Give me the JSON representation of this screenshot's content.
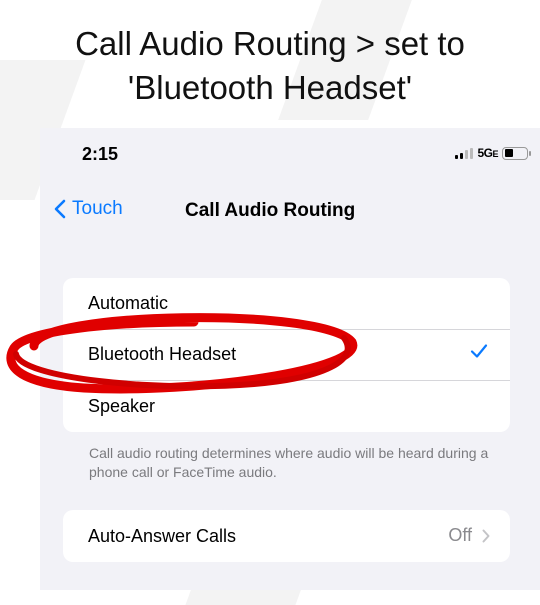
{
  "caption": {
    "line1": "Call Audio Routing > set to",
    "line2": "'Bluetooth Headset'"
  },
  "status_bar": {
    "time": "2:15",
    "network": "5G",
    "network_suffix": "E",
    "battery_icon": "battery-icon",
    "signal_icon": "signal-bars-icon"
  },
  "nav": {
    "back_label": "Touch",
    "back_icon": "chevron-left-icon",
    "title": "Call Audio Routing"
  },
  "routing_options": [
    {
      "label": "Automatic",
      "selected": false
    },
    {
      "label": "Bluetooth Headset",
      "selected": true
    },
    {
      "label": "Speaker",
      "selected": false
    }
  ],
  "routing_note": "Call audio routing determines where audio will be heard during a phone call or FaceTime audio.",
  "auto_answer": {
    "label": "Auto-Answer Calls",
    "value": "Off"
  },
  "colors": {
    "accent": "#0a7aff",
    "annotation": "#e00000",
    "background": "#f2f2f7"
  }
}
